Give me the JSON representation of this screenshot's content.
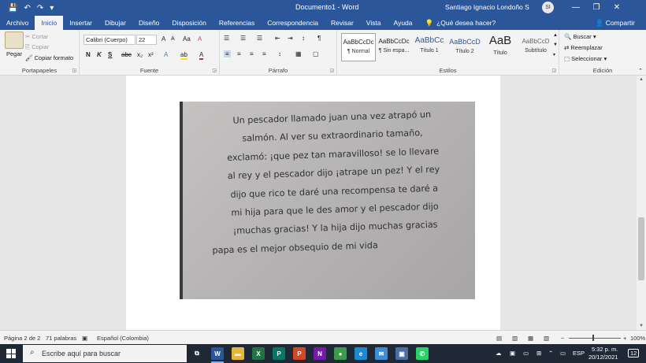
{
  "titlebar": {
    "doc_title": "Documento1  -  Word",
    "user": "Santiago Ignacio Londoño S",
    "initials": "SI",
    "qat": [
      "💾",
      "↶",
      "↷",
      "▾"
    ],
    "controls": [
      "—",
      "❐",
      "✕"
    ]
  },
  "tabs": {
    "items": [
      "Archivo",
      "Inicio",
      "Insertar",
      "Dibujar",
      "Diseño",
      "Disposición",
      "Referencias",
      "Correspondencia",
      "Revisar",
      "Vista",
      "Ayuda"
    ],
    "active": "Inicio",
    "tell_me": "¿Qué desea hacer?",
    "share": "Compartir"
  },
  "ribbon": {
    "clipboard": {
      "label": "Portapapeles",
      "paste": "Pegar",
      "cut": "Cortar",
      "copy": "Copiar",
      "format_painter": "Copiar formato"
    },
    "font": {
      "label": "Fuente",
      "font_name": "Calibri (Cuerpo)",
      "font_size": "22",
      "row1": [
        "A",
        "A",
        "Aa",
        "A"
      ],
      "row2": [
        "N",
        "K",
        "S",
        "abc",
        "x₂",
        "x²",
        "A",
        "ab",
        "A"
      ]
    },
    "paragraph": {
      "label": "Párrafo",
      "row1": [
        "☰",
        "☰",
        "☰",
        "⇤",
        "⇥",
        "↕",
        "¶"
      ],
      "row2": [
        "≡",
        "≡",
        "≡",
        "≡",
        "↕",
        "▦",
        "▢"
      ]
    },
    "styles": {
      "label": "Estilos",
      "items": [
        {
          "sample": "AaBbCcDc",
          "name": "¶ Normal"
        },
        {
          "sample": "AaBbCcDc",
          "name": "¶ Sin espa..."
        },
        {
          "sample": "AaBbCc",
          "name": "Título 1"
        },
        {
          "sample": "AaBbCcD",
          "name": "Título 2"
        },
        {
          "sample": "AaB",
          "name": "Título"
        },
        {
          "sample": "AaBbCcD",
          "name": "Subtítulo"
        }
      ]
    },
    "editing": {
      "label": "Edición",
      "find": "Buscar",
      "replace": "Reemplazar",
      "select": "Seleccionar"
    }
  },
  "document": {
    "photo_lines": [
      "Un pescador llamado juan una vez atrapó un",
      "salmón. Al ver su extraordinario tamaño,",
      "exclamó: ¡que pez tan maravilloso! se lo llevare",
      "al rey y el pescador dijo ¡atrape un pez! Y el rey",
      "dijo que rico te daré una recompensa te daré a",
      "mi hija para que le des amor y el pescador dijo",
      "¡muchas gracias! Y la hija dijo muchas gracias",
      "papa es el mejor obsequio de mi vida"
    ]
  },
  "statusbar": {
    "page": "Página 2 de 2",
    "words": "71 palabras",
    "language": "Español (Colombia)",
    "zoom": "100%"
  },
  "taskbar": {
    "search_placeholder": "Escribe aquí para buscar",
    "apps": [
      {
        "name": "task-view",
        "glyph": "⧉",
        "color": "#1f2936"
      },
      {
        "name": "word",
        "glyph": "W",
        "color": "#2b579a"
      },
      {
        "name": "file-explorer",
        "glyph": "▬",
        "color": "#e8b43a"
      },
      {
        "name": "excel",
        "glyph": "X",
        "color": "#217346"
      },
      {
        "name": "publisher",
        "glyph": "P",
        "color": "#077568"
      },
      {
        "name": "powerpoint",
        "glyph": "P",
        "color": "#d24726"
      },
      {
        "name": "onenote",
        "glyph": "N",
        "color": "#7719aa"
      },
      {
        "name": "chrome",
        "glyph": "●",
        "color": "#3a9b4c"
      },
      {
        "name": "edge",
        "glyph": "e",
        "color": "#1b8ad1"
      },
      {
        "name": "mail",
        "glyph": "✉",
        "color": "#3c8dd6"
      },
      {
        "name": "store",
        "glyph": "▣",
        "color": "#4a6fa5"
      },
      {
        "name": "whatsapp",
        "glyph": "✆",
        "color": "#25d366"
      }
    ],
    "tray_lang": "ESP",
    "time": "5:32 p. m.",
    "date": "20/12/2021",
    "notifications": "12"
  },
  "colors": {
    "word_blue": "#2b579a",
    "taskbar": "#1f2936",
    "ribbon": "#f3f3f3"
  }
}
